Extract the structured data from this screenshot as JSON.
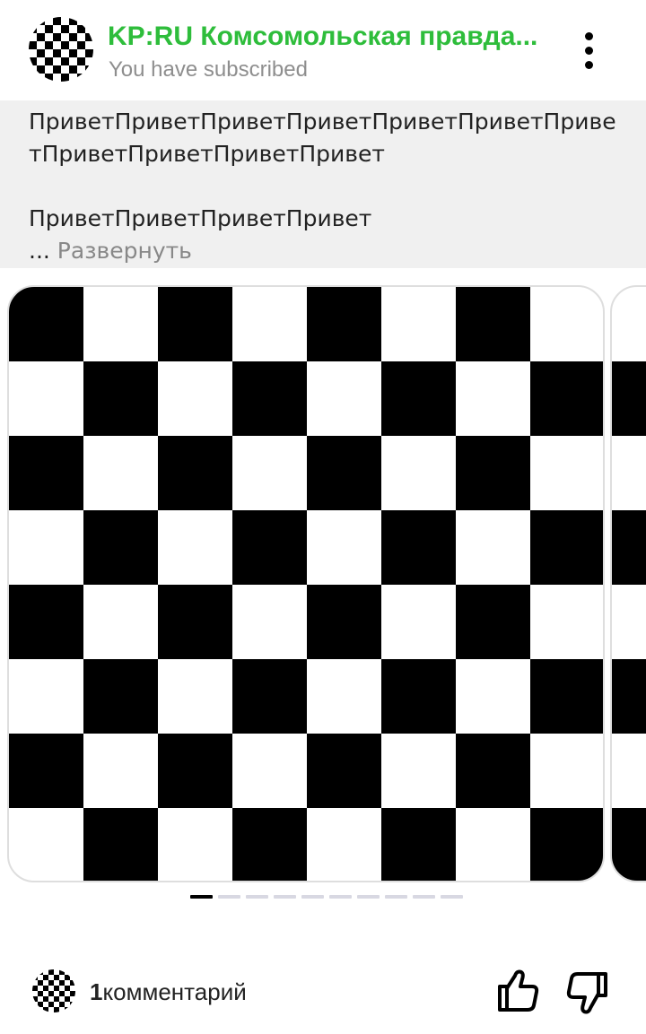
{
  "header": {
    "channel_name": "KP:RU Комсомольская правда...",
    "subscription_status": "You have subscribed",
    "menu_icon": "more-vertical-icon"
  },
  "post": {
    "paragraph_1": "ПриветПриветПриветПриветПриветПриветПриветПриветПриветПриветПривет",
    "paragraph_2": "ПриветПриветПриветПривет",
    "ellipsis": "...",
    "expand_label": "Развернуть"
  },
  "carousel": {
    "slide_count": 10,
    "active_index": 0
  },
  "footer": {
    "comment_count": "1",
    "comment_label": "комментарий",
    "like_icon": "thumbs-up-icon",
    "dislike_icon": "thumbs-down-icon"
  },
  "colors": {
    "channel_name": "#2ebd3b",
    "subtitle": "#8e8e8e",
    "text_block_bg": "#f0f0f0",
    "dot_inactive": "#d8d8e2",
    "dot_active": "#000000"
  }
}
